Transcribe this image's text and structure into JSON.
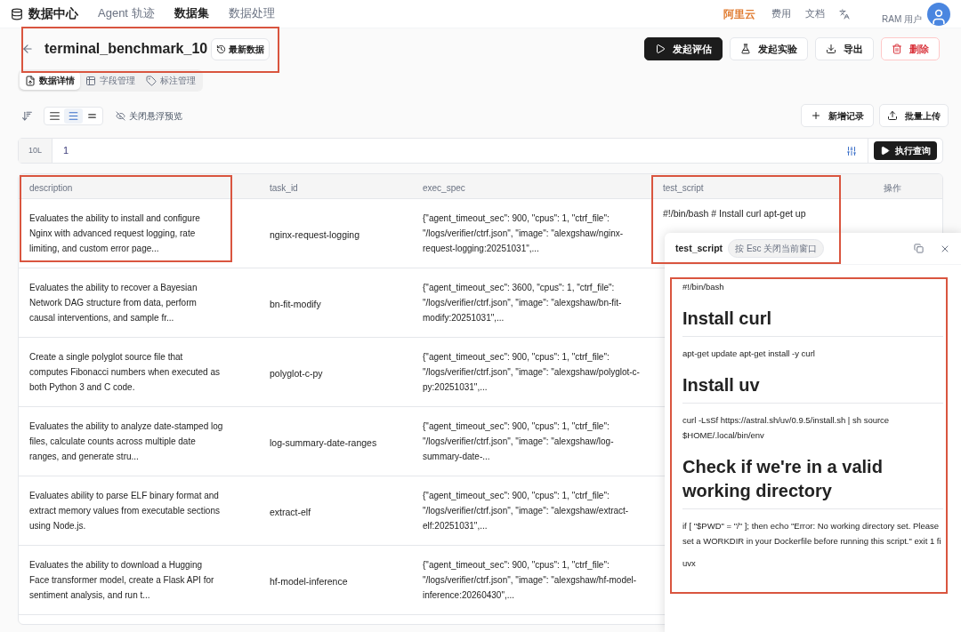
{
  "nav": {
    "brand": "数据中心",
    "tabs": [
      {
        "label": "Agent 轨迹",
        "selected": false
      },
      {
        "label": "数据集",
        "selected": true
      },
      {
        "label": "数据处理",
        "selected": false
      }
    ],
    "cloud": "阿里云",
    "links": [
      "费用",
      "文档"
    ],
    "user": "RAM 用户"
  },
  "header": {
    "title": "terminal_benchmark_10",
    "version_button": "最新数据",
    "actions": [
      {
        "label": "发起评估",
        "kind": "primary"
      },
      {
        "label": "发起实验",
        "kind": "flask"
      },
      {
        "label": "导出",
        "kind": "export"
      },
      {
        "label": "删除",
        "kind": "danger"
      }
    ]
  },
  "subtabs": [
    {
      "label": "数据详情",
      "selected": true,
      "kind": "detail"
    },
    {
      "label": "字段管理",
      "selected": false,
      "kind": "fields"
    },
    {
      "label": "标注管理",
      "selected": false,
      "kind": "tags"
    }
  ],
  "toolbar": {
    "density": [
      {
        "kind": "compact",
        "selected": false
      },
      {
        "kind": "medium",
        "selected": true
      },
      {
        "kind": "loose",
        "selected": false
      }
    ],
    "hover_toggle": "关闭悬浮预览",
    "add": "新增记录",
    "upload": "批量上传"
  },
  "query": {
    "limit": "10L",
    "line": "1",
    "run": "执行查询"
  },
  "table": {
    "columns": [
      "description",
      "task_id",
      "exec_spec",
      "test_script",
      "操作"
    ],
    "rows": [
      {
        "description": "Evaluates the ability to install and configure Nginx with advanced request logging, rate limiting, and custom error page...",
        "task_id": "nginx-request-logging",
        "exec_spec": "{\"agent_timeout_sec\": 900, \"cpus\": 1, \"ctrf_file\": \"/logs/verifier/ctrf.json\", \"image\": \"alexgshaw/nginx-request-logging:20251031\",...",
        "test_script": "#!/bin/bash # Install curl apt-get up"
      },
      {
        "description": "Evaluates the ability to recover a Bayesian Network DAG structure from data, perform causal interventions, and sample fr...",
        "task_id": "bn-fit-modify",
        "exec_spec": "{\"agent_timeout_sec\": 3600, \"cpus\": 1, \"ctrf_file\": \"/logs/verifier/ctrf.json\", \"image\": \"alexgshaw/bn-fit-modify:20251031\",..."
      },
      {
        "description": "Create a single polyglot source file that computes Fibonacci numbers when executed as both Python 3 and C code.",
        "task_id": "polyglot-c-py",
        "exec_spec": "{\"agent_timeout_sec\": 900, \"cpus\": 1, \"ctrf_file\": \"/logs/verifier/ctrf.json\", \"image\": \"alexgshaw/polyglot-c-py:20251031\",..."
      },
      {
        "description": "Evaluates the ability to analyze date-stamped log files, calculate counts across multiple date ranges, and generate stru...",
        "task_id": "log-summary-date-ranges",
        "exec_spec": "{\"agent_timeout_sec\": 900, \"cpus\": 1, \"ctrf_file\": \"/logs/verifier/ctrf.json\", \"image\": \"alexgshaw/log-summary-date-..."
      },
      {
        "description": "Evaluates ability to parse ELF binary format and extract memory values from executable sections using Node.js.",
        "task_id": "extract-elf",
        "exec_spec": "{\"agent_timeout_sec\": 900, \"cpus\": 1, \"ctrf_file\": \"/logs/verifier/ctrf.json\", \"image\": \"alexgshaw/extract-elf:20251031\",..."
      },
      {
        "description": "Evaluates the ability to download a Hugging Face transformer model, create a Flask API for sentiment analysis, and run t...",
        "task_id": "hf-model-inference",
        "exec_spec": "{\"agent_timeout_sec\": 900, \"cpus\": 1, \"ctrf_file\": \"/logs/verifier/ctrf.json\", \"image\": \"alexgshaw/hf-model-inference:20260430\",..."
      }
    ]
  },
  "popup": {
    "title": "test_script",
    "hint": "按 Esc 关闭当前窗口",
    "blocks": [
      {
        "kind": "text",
        "text": "#!/bin/bash"
      },
      {
        "kind": "heading",
        "text": "Install curl"
      },
      {
        "kind": "text",
        "text": "apt-get update apt-get install -y curl"
      },
      {
        "kind": "heading",
        "text": "Install uv"
      },
      {
        "kind": "text",
        "text": "curl -LsSf https://astral.sh/uv/0.9.5/install.sh | sh source $HOME/.local/bin/env"
      },
      {
        "kind": "heading",
        "text": "Check if we're in a valid working directory"
      },
      {
        "kind": "text",
        "text": "if [ \"$PWD\" = \"/\" ]; then echo \"Error: No working directory set. Please set a WORKDIR in your Dockerfile before running this script.\" exit 1 fi"
      },
      {
        "kind": "text",
        "text": "uvx"
      }
    ]
  }
}
